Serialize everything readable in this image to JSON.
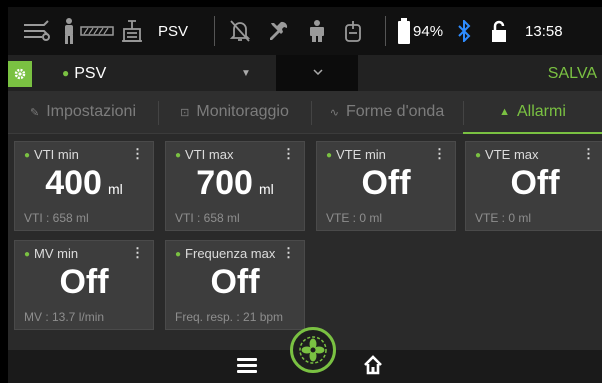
{
  "status": {
    "mode_label": "PSV",
    "battery": "94%",
    "time": "13:58",
    "icons": [
      "patient-circuit-icon",
      "adult-patient-icon",
      "tube-icon",
      "ventilator-icon",
      "alarm-silenced-icon",
      "tools-icon",
      "person-icon",
      "ventilation-icon",
      "battery-icon",
      "bluetooth-icon",
      "lock-open-icon"
    ]
  },
  "mode_bar": {
    "selected_mode": "PSV",
    "save_label": "SALVA"
  },
  "tabs": [
    {
      "label": "Impostazioni",
      "icon": "settings-icon",
      "active": false
    },
    {
      "label": "Monitoraggio",
      "icon": "monitor-icon",
      "active": false
    },
    {
      "label": "Forme d'onda",
      "icon": "waveform-icon",
      "active": false
    },
    {
      "label": "Allarmi",
      "icon": "bell-icon",
      "active": true
    }
  ],
  "alarms": [
    {
      "title": "VTI min",
      "value": "400",
      "unit": "ml",
      "footer": "VTI : 658 ml",
      "dot_color": "#7ac142"
    },
    {
      "title": "VTI max",
      "value": "700",
      "unit": "ml",
      "footer": "VTI : 658 ml",
      "dot_color": "#7ac142"
    },
    {
      "title": "VTE min",
      "value": "Off",
      "unit": "",
      "footer": "VTE : 0 ml",
      "dot_color": "#dcdcdc"
    },
    {
      "title": "VTE max",
      "value": "Off",
      "unit": "",
      "footer": "VTE : 0 ml",
      "dot_color": "#dcdcdc"
    },
    {
      "title": "MV min",
      "value": "Off",
      "unit": "",
      "footer": "MV : 13.7 l/min",
      "dot_color": "#dcdcdc"
    },
    {
      "title": "Frequenza max",
      "value": "Off",
      "unit": "",
      "footer": "Freq. resp. : 21 bpm",
      "dot_color": "#dcdcdc"
    }
  ],
  "colors": {
    "accent": "#7ac142",
    "background": "#2a2a2a",
    "card": "#3d3d3d"
  }
}
